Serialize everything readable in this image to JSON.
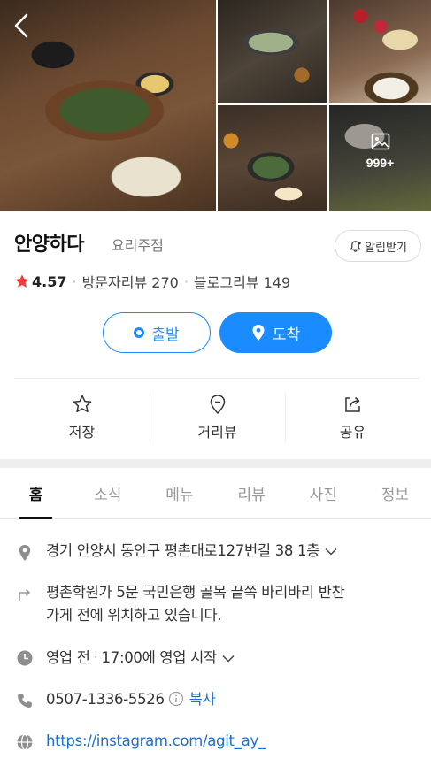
{
  "gallery": {
    "more_count": "999+"
  },
  "place": {
    "name": "안양하다",
    "category": "요리주점",
    "notify_label": "알림받기",
    "rating": "4.57",
    "visitor_reviews": "방문자리뷰 270",
    "blog_reviews": "블로그리뷰 149"
  },
  "actions": {
    "depart": "출발",
    "arrive": "도착"
  },
  "quick": {
    "save": "저장",
    "street_view": "거리뷰",
    "share": "공유"
  },
  "tabs": [
    "홈",
    "소식",
    "메뉴",
    "리뷰",
    "사진",
    "정보"
  ],
  "info": {
    "address": "경기 안양시 동안구 평촌대로127번길 38 1층",
    "directions_line1": "평촌학원가 5문 국민은행 골목 끝쪽 바리바리 반찬",
    "directions_line2": "가게 전에 위치하고 있습니다.",
    "hours_status": "영업 전",
    "hours_detail": "17:00에 영업 시작",
    "phone": "0507-1336-5526",
    "copy_label": "복사",
    "website": "https://instagram.com/agit_ay_"
  },
  "colors": {
    "accent": "#1a8cff",
    "star": "#f23b3b",
    "link": "#1a6fd6"
  }
}
